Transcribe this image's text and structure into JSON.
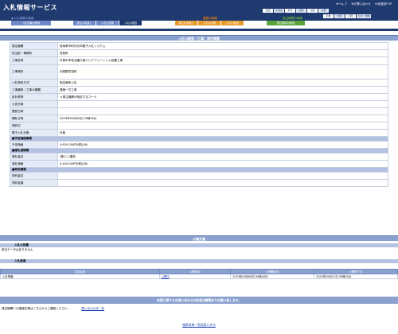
{
  "header": {
    "title": "入札情報サービス",
    "links": [
      "★ヘルプ",
      "★お問い合わせ",
      "★全国版TOP"
    ],
    "prefs_row1": [
      "全国",
      "北海道",
      "東北",
      "関東",
      "北陸",
      "中部"
    ],
    "prefs_row2": [
      "近畿",
      "中国",
      "四国",
      "九州・沖縄"
    ]
  },
  "categories": {
    "kensaku_title": "●入札情報の検索",
    "koji_title": "工事の検索",
    "gyomu_title": "業務の検索",
    "hatchu_title": "発注機関の検索",
    "tabs_a": [
      "入札情報の検索",
      "発注の見通し",
      "入札公告等",
      "入札の経過"
    ],
    "tabs_b": [
      "発注の見通し",
      "入札公告等",
      "入札の経過"
    ],
    "tabs_c": [
      "発注機関の検索"
    ]
  },
  "detail": {
    "title": "入札の経過（工事）案件概要",
    "rows": [
      [
        "発注機関",
        "岐阜県市町村共同電子入札システム"
      ],
      [
        "担当部・事務所",
        "笠松町"
      ],
      [
        "工事名称",
        "竹鼻中学校北通り線バリアフリートイレ設置工事"
      ],
      [
        "工事場所",
        "羽島郡笠松町"
      ],
      [
        "入札契約方式",
        "指名競争入札"
      ],
      [
        "工事種別／工事の種類",
        "建築一式工事"
      ],
      [
        "設計書等",
        "＊発注機関が指定するコード"
      ],
      [
        "公告日時",
        ""
      ],
      [
        "閲覧日時",
        ""
      ],
      [
        "開札日時",
        "2023年09月06日 09時30分"
      ],
      [
        "契約日",
        ""
      ],
      [
        "電子入札対象",
        "対象"
      ]
    ],
    "band1": "■予定価格情報",
    "band1_rows": [
      [
        "予定価格",
        "4,620,000円(税込み)"
      ]
    ],
    "band2": "■落札者情報",
    "band2_rows": [
      [
        "落札者名",
        "(株)○○建設"
      ],
      [
        "落札価格",
        "4,444,000円(税込み)"
      ]
    ],
    "band3": "■契約情報",
    "band3_rows": [
      [
        "契約者名",
        ""
      ],
      [
        "契約金額",
        ""
      ]
    ]
  },
  "docs": {
    "title": "公開文書",
    "koukoku_hdr": "入札公告書",
    "koukoku_note": "該当データはありません",
    "keika_hdr": "入札経過",
    "columns": [
      "文書名称",
      "公開状況",
      "公開開始日",
      "公開終了日"
    ],
    "rows": [
      [
        "入札情報",
        "公開中",
        "2023年09月06日 09時40分",
        "2023年09月21日 09時00分"
      ]
    ]
  },
  "contact": {
    "bar": "内容に関するお問い合わせは各発注機関までお願い致します。",
    "line": "発注機関への連絡先等はこちらからご確認ください。",
    "link": "問い合わせ先一覧"
  },
  "back": "検索結果一覧画面に戻る"
}
